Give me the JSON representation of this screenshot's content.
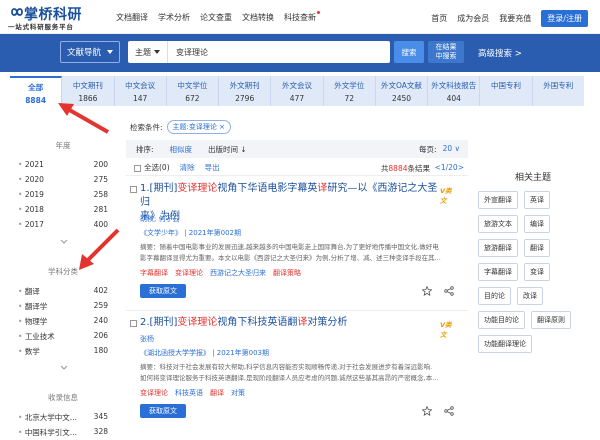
{
  "brand": {
    "name": "掌桥科研",
    "tagline": "一站式科研服务平台"
  },
  "topnav": [
    "文档翻译",
    "学术分析",
    "论文查重",
    "文档转换",
    "科技查新"
  ],
  "topright": {
    "home": "首页",
    "member": "成为会员",
    "recharge": "我要充值",
    "login": "登录/注册"
  },
  "search": {
    "nav_label": "文献导航",
    "field_label": "主题",
    "query": "变译理论",
    "search_btn": "搜索",
    "within_line1": "在结果",
    "within_line2": "中搜索",
    "advanced": "高级搜索 >"
  },
  "tabs": [
    {
      "label": "全部",
      "count": "8884"
    },
    {
      "label": "中文期刊",
      "count": "1866"
    },
    {
      "label": "中文会议",
      "count": "147"
    },
    {
      "label": "中文学位",
      "count": "672"
    },
    {
      "label": "外文期刊",
      "count": "2796"
    },
    {
      "label": "外文会议",
      "count": "477"
    },
    {
      "label": "外文学位",
      "count": "72"
    },
    {
      "label": "外文OA文献",
      "count": "2450"
    },
    {
      "label": "外文科技报告",
      "count": "404"
    },
    {
      "label": "中国专利",
      "count": ""
    },
    {
      "label": "外国专利",
      "count": ""
    }
  ],
  "sidebar": {
    "year_title": "年度",
    "years": [
      {
        "label": "2021",
        "count": "200"
      },
      {
        "label": "2020",
        "count": "275"
      },
      {
        "label": "2019",
        "string": "",
        "count": "258"
      },
      {
        "label": "2018",
        "count": "281"
      },
      {
        "label": "2017",
        "count": "400"
      }
    ],
    "subject_title": "学科分类",
    "subjects": [
      {
        "label": "翻译",
        "count": "402"
      },
      {
        "label": "翻译学",
        "count": "259"
      },
      {
        "label": "物理学",
        "count": "240"
      },
      {
        "label": "工业技术",
        "count": "206"
      },
      {
        "label": "数学",
        "count": "180"
      }
    ],
    "collection_title": "收录信息",
    "collections": [
      {
        "label": "北京大学中文...",
        "count": "345"
      },
      {
        "label": "中国科学引文...",
        "count": "328"
      }
    ]
  },
  "conditions": {
    "label": "检索条件:",
    "tag": "主题:变译理论",
    "tag_close": "×"
  },
  "sortbar": {
    "label": "排序:",
    "relevance": "相似度",
    "date": "出版时间 ↓",
    "perpage_label": "每页:",
    "perpage_value": "20 ∨"
  },
  "toolbar": {
    "select_all": "全选",
    "select_count": "(0)",
    "clear": "清除",
    "export": "导出",
    "total_prefix": "共",
    "total_count": "8884",
    "total_suffix": "条结果",
    "pager": "<1/20>"
  },
  "results": [
    {
      "title_a": "1.[期刊]",
      "title_b": "变译理论",
      "title_c": "视角下华语电影字幕英",
      "title_d": "译",
      "title_e": "研究—以《西游记之大圣归",
      "title_f": "来》为例",
      "badge": "V类文",
      "authors": "胡枚; 何子云",
      "source": "《文学少年》 | 2021年第002期",
      "abstract_1": "摘要：随着中国电影事业的发展迅速,越来越多的中国电影走上国际舞台,为了更好地传播中国文化,做好电",
      "abstract_2": "影字幕翻译显得尤为重要。本文以电影《西游记之大圣归来》为例,分析了增、减、述三种变译手段在其...",
      "keywords": [
        {
          "text": "字幕翻译",
          "hl": true
        },
        {
          "text": "变译理论",
          "hl": true
        },
        {
          "text": "西游记之大圣归来",
          "hl": false
        },
        {
          "text": "翻译策略",
          "hl": true
        }
      ],
      "btn": "获取原文"
    },
    {
      "title_a": "2.[期刊]",
      "title_b": "变译理论",
      "title_c": "视角下科技英语翻",
      "title_d": "译",
      "title_e": "对策分析",
      "title_f": "",
      "badge": "V类文",
      "authors": "张杨",
      "source": "《湖北函授大学学报》 | 2021年第003期",
      "abstract_1": "摘要：科技对于社会发展有较大帮助,科学信息内容能否实现顺畅传递,对于社会发展进步有着深远影响.",
      "abstract_2": "如何将变译理论服务于科技英语翻译,是现阶段翻译人员应考虑的问题,诚然这些基其高昂的严密概念,本...",
      "keywords": [
        {
          "text": "变译理论",
          "hl": true
        },
        {
          "text": "科技英语",
          "hl": false
        },
        {
          "text": "翻译",
          "hl": true
        },
        {
          "text": "对策",
          "hl": false
        }
      ],
      "btn": "获取原文"
    }
  ],
  "topics": {
    "title": "相关主题",
    "chips": [
      "外宣翻译",
      "英译",
      "旅游文本",
      "编译",
      "旅游翻译",
      "翻译",
      "字幕翻译",
      "变译",
      "目的论",
      "改译",
      "功能目的论",
      "翻译原则",
      "功能翻译理论"
    ]
  },
  "colors": {
    "primary": "#2a5db0",
    "accent": "#2a6fd6",
    "highlight": "#e3342f",
    "arrow": "#e3342f"
  }
}
